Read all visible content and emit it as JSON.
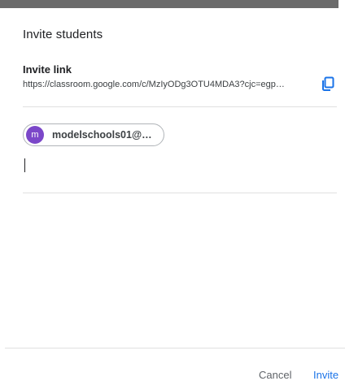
{
  "dialog": {
    "title": "Invite students",
    "invite_link": {
      "label": "Invite link",
      "url": "https://classroom.google.com/c/MzIyODg3OTU4MDA3?cjc=egp…",
      "copy_icon": "copy-icon"
    },
    "recipients": [
      {
        "avatar_letter": "m",
        "label": "modelschools01@…",
        "avatar_color": "#7b47c9"
      }
    ],
    "footer": {
      "cancel_label": "Cancel",
      "invite_label": "Invite"
    },
    "colors": {
      "accent": "#1a73e8",
      "copy_icon": "#1a73e8"
    }
  }
}
